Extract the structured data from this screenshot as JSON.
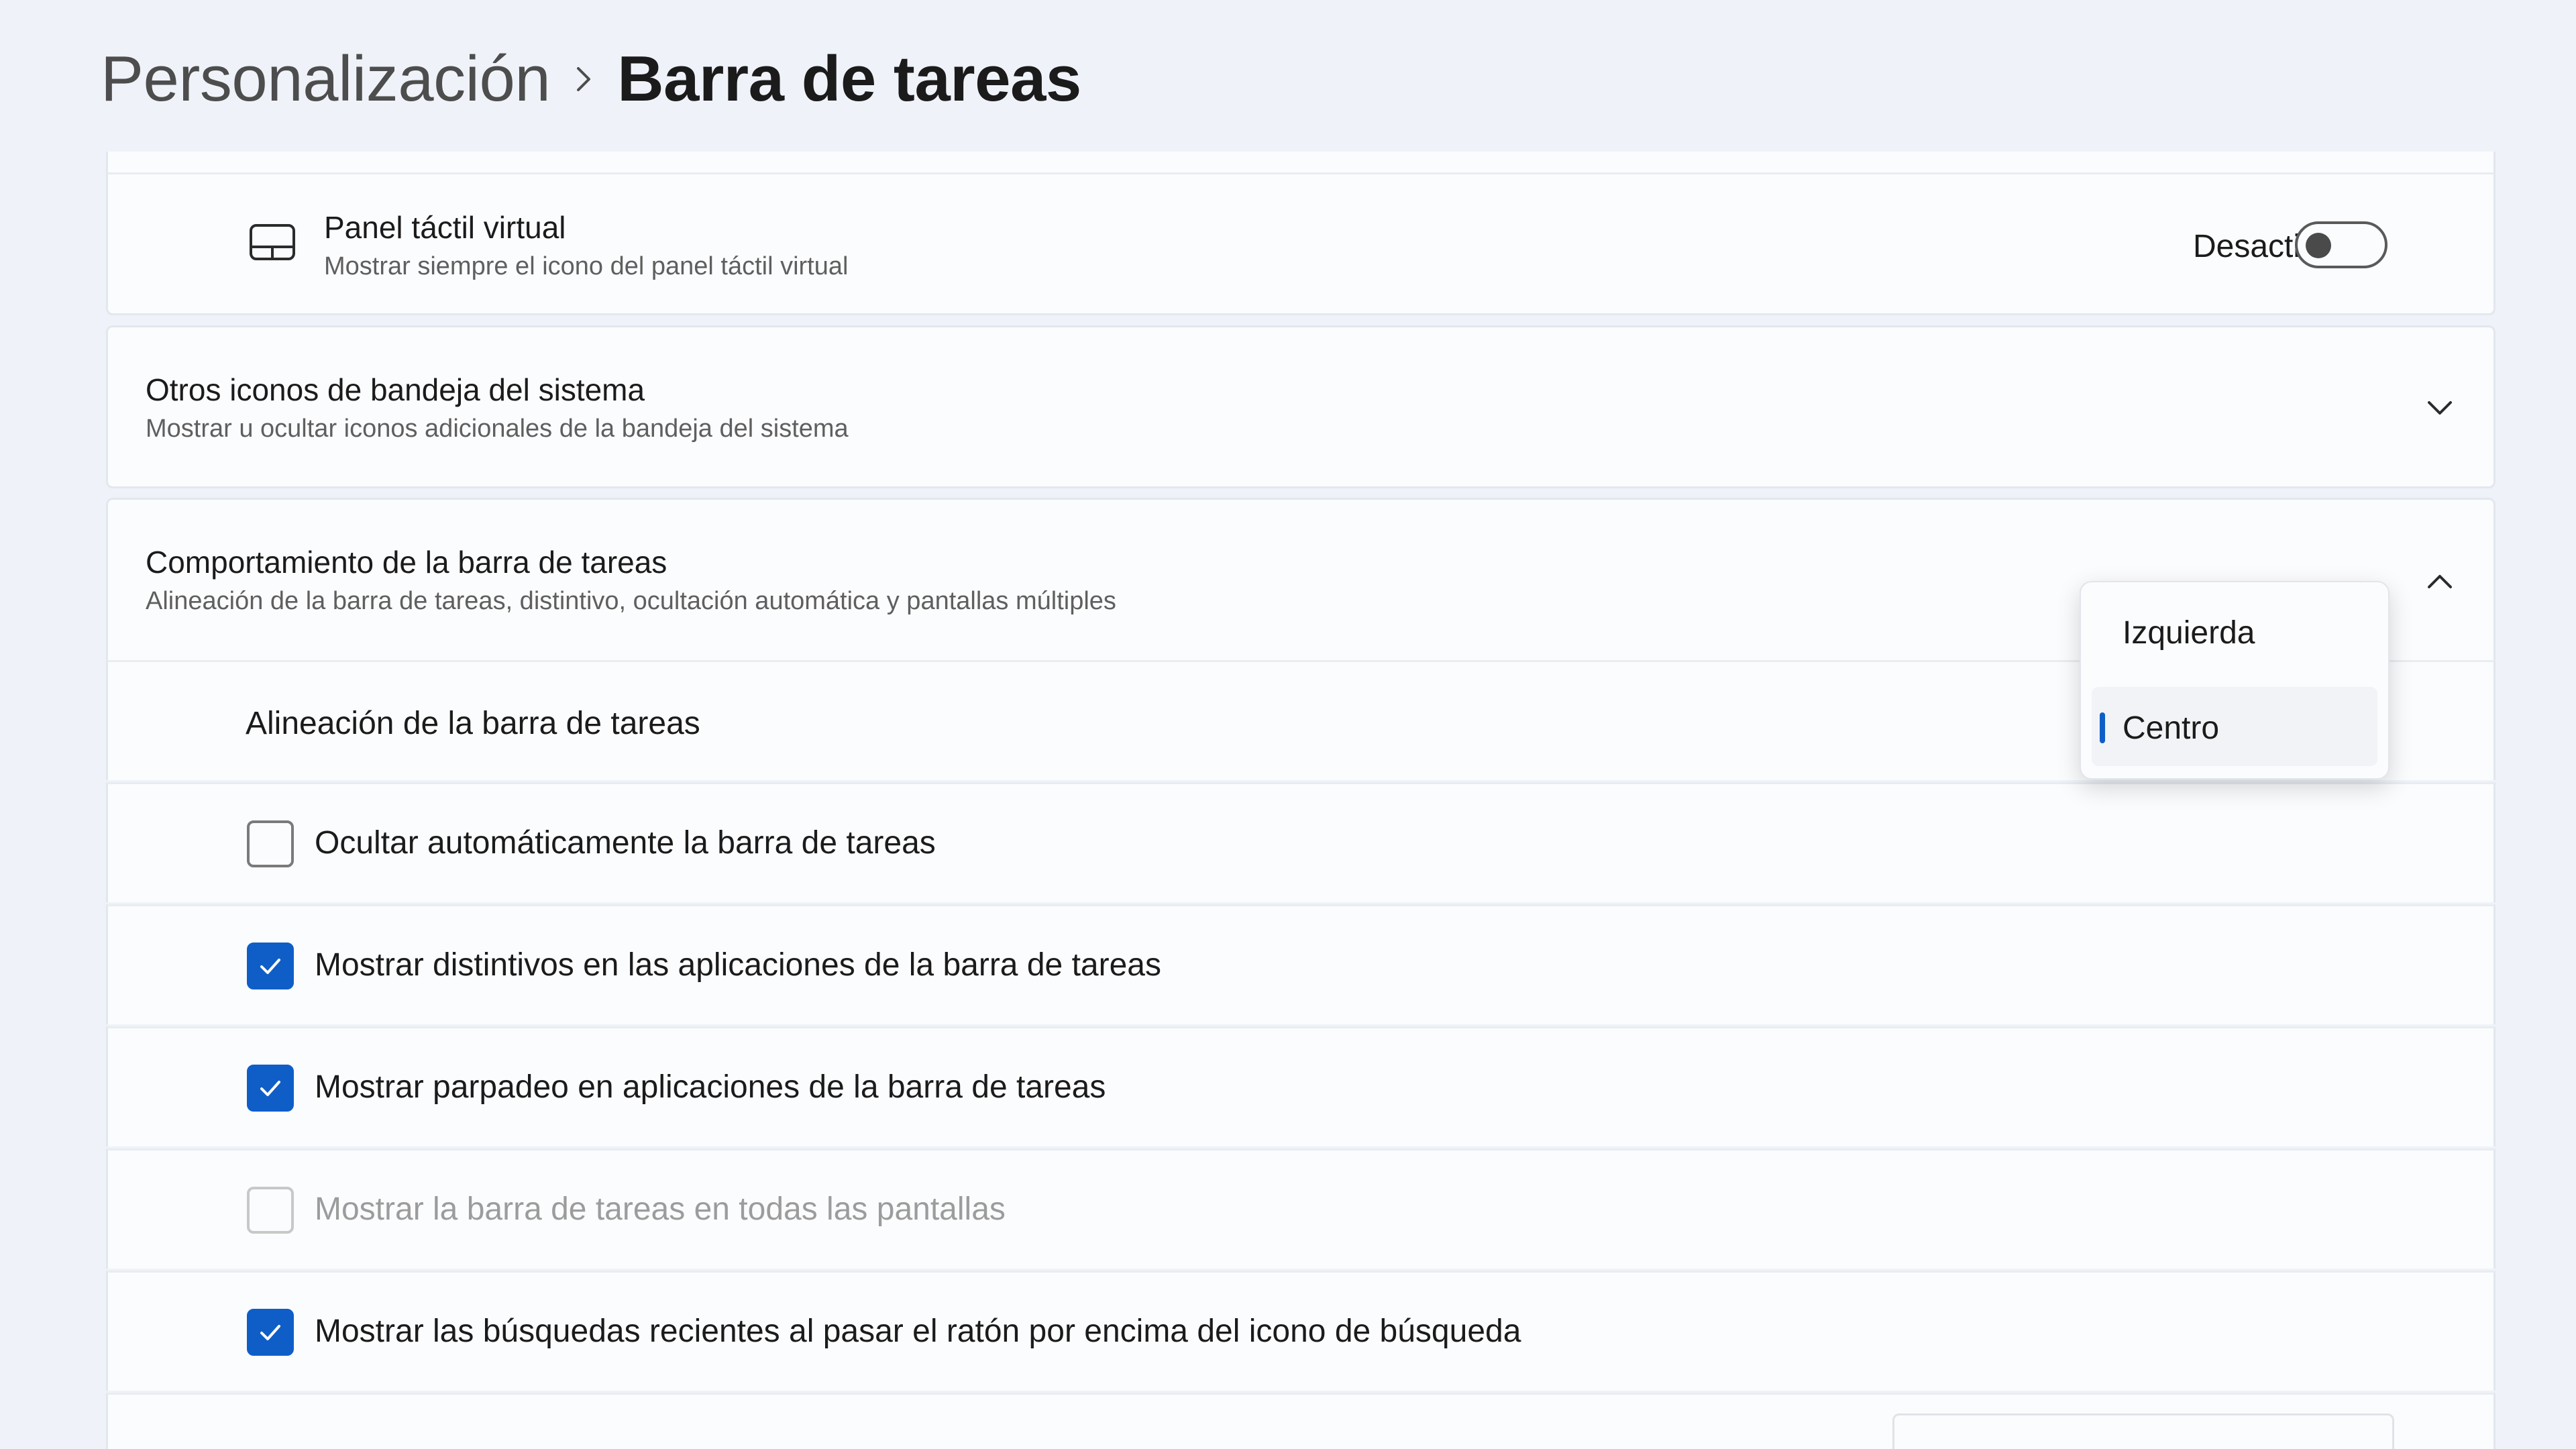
{
  "breadcrumb": {
    "parent": "Personalización",
    "current": "Barra de tareas"
  },
  "panel_tactil": {
    "title": "Panel táctil virtual",
    "subtitle": "Mostrar siempre el icono del panel táctil virtual",
    "state_label": "Desactivado",
    "toggle_on": false
  },
  "otros_iconos": {
    "title": "Otros iconos de bandeja del sistema",
    "subtitle": "Mostrar u ocultar iconos adicionales de la bandeja del sistema",
    "expanded": false
  },
  "comportamiento": {
    "title": "Comportamiento de la barra de tareas",
    "subtitle": "Alineación de la barra de tareas, distintivo, ocultación automática y pantallas múltiples",
    "expanded": true,
    "alignment_label": "Alineación de la barra de tareas",
    "alignment_options": [
      "Izquierda",
      "Centro"
    ],
    "alignment_selected": "Centro",
    "options": [
      {
        "label": "Ocultar automáticamente la barra de tareas",
        "checked": false,
        "disabled": false
      },
      {
        "label": "Mostrar distintivos en las aplicaciones de la barra de tareas",
        "checked": true,
        "disabled": false
      },
      {
        "label": "Mostrar parpadeo en aplicaciones de la barra de tareas",
        "checked": true,
        "disabled": false
      },
      {
        "label": "Mostrar la barra de tareas en todas las pantallas",
        "checked": false,
        "disabled": true
      },
      {
        "label": "Mostrar las búsquedas recientes al pasar el ratón por encima del icono de búsqueda",
        "checked": true,
        "disabled": false
      }
    ]
  },
  "colors": {
    "accent": "#0f5ec7",
    "background": "#eff3f9",
    "card": "#fbfcfe"
  }
}
